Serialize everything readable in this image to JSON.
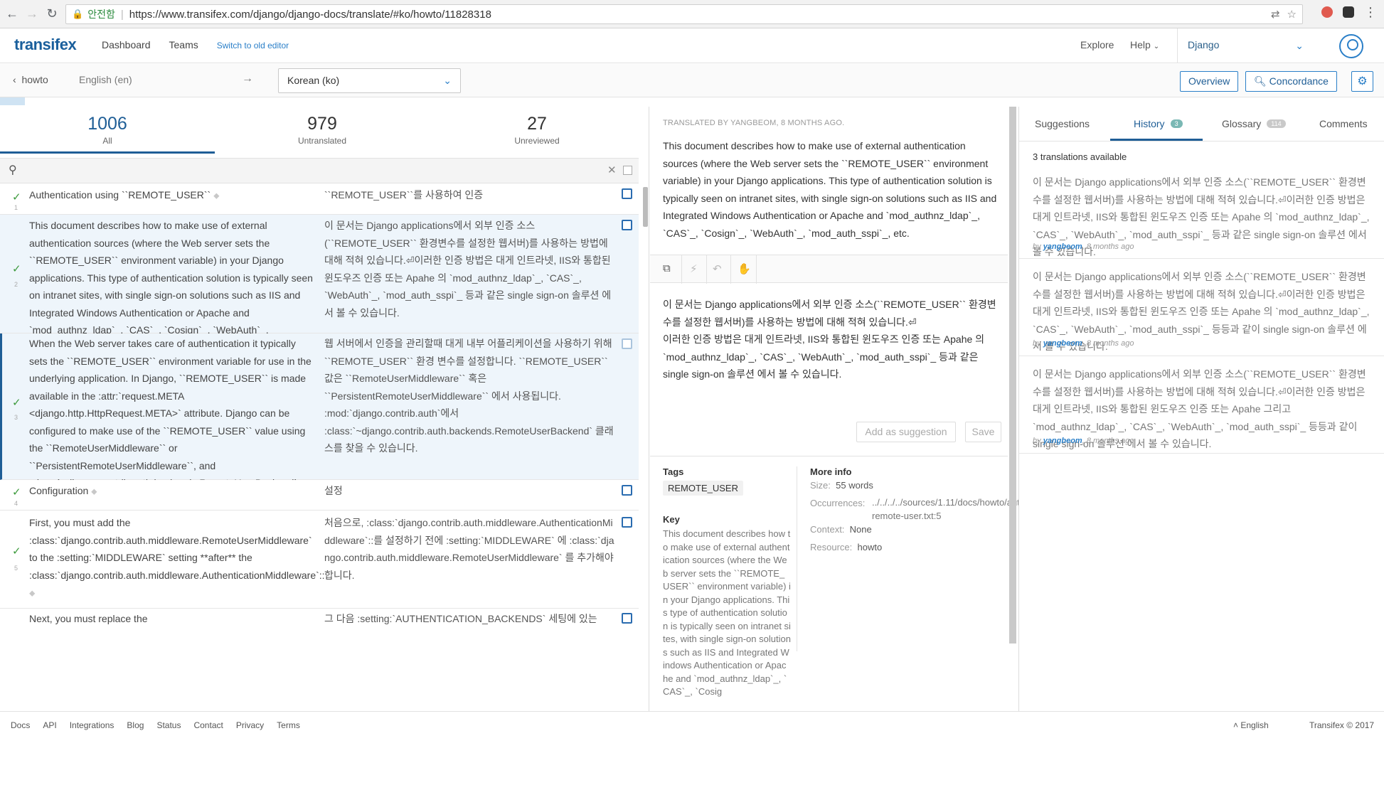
{
  "browser": {
    "secure_label": "안전함",
    "url": "https://www.transifex.com/django/django-docs/translate/#ko/howto/11828318"
  },
  "header": {
    "logo": "transifex",
    "nav": [
      "Dashboard",
      "Teams"
    ],
    "switch_link": "Switch to old editor",
    "explore": "Explore",
    "help": "Help",
    "project": "Django"
  },
  "toolbar": {
    "breadcrumb": "howto",
    "source_lang": "English (en)",
    "arrow": "→",
    "target_lang": "Korean (ko)",
    "overview": "Overview",
    "concordance": "Concordance"
  },
  "stats": [
    {
      "num": "1006",
      "label": "All"
    },
    {
      "num": "979",
      "label": "Untranslated"
    },
    {
      "num": "27",
      "label": "Unreviewed"
    }
  ],
  "search": {
    "placeholder": ""
  },
  "rows": [
    {
      "idx": "1",
      "src": "Authentication using ``REMOTE_USER``",
      "tgt": "``REMOTE_USER``를 사용하여 인증"
    },
    {
      "idx": "2",
      "src": "This document describes how to make use of external authentication sources (where the Web server sets the ``REMOTE_USER`` environment variable) in your Django applications. This type of authentication solution is typically seen on intranet sites, with single sign-on solutions such as IIS and Integrated Windows Authentication or Apache and `mod_authnz_ldap`_, `CAS`_, `Cosign`_, `WebAuth`_, `mod_auth_sspi`_, etc.",
      "tgt": "이 문서는 Django applications에서 외부 인증 소스(``REMOTE_USER`` 환경변수를 설정한 웹서버)를 사용하는 방법에 대해 적혀 있습니다.⏎이러한 인증 방법은 대게 인트라넷, IIS와 통합된 윈도우즈 인증 또는 Apahe 의 `mod_authnz_ldap`_, `CAS`_, `WebAuth`_, `mod_auth_sspi`_ 등과 같은 single sign-on 솔루션 에서 볼 수 있습니다."
    },
    {
      "idx": "3",
      "src": "When the Web server takes care of authentication it typically sets the ``REMOTE_USER`` environment variable for use in the underlying application. In Django, ``REMOTE_USER`` is made available in the :attr:`request.META <django.http.HttpRequest.META>` attribute. Django can be configured to make use of the ``REMOTE_USER`` value using the ``RemoteUserMiddleware`` or ``PersistentRemoteUserMiddleware``, and :class:`~django.contrib.auth.backends.RemoteUserBackend` classes found in :mod:`django.contrib.auth`.",
      "tgt": "웹 서버에서 인증을 관리할때 대게 내부 어플리케이션을 사용하기 위해 ``REMOTE_USER`` 환경 변수를 설정합니다. ``REMOTE_USER`` 값은 ``RemoteUserMiddleware`` 혹은 ``PersistentRemoteUserMiddleware`` 에서 사용됩니다. :mod:`django.contrib.auth`에서 :class:`~django.contrib.auth.backends.RemoteUserBackend` 클래스를 찾을 수 있습니다."
    },
    {
      "idx": "4",
      "src": "Configuration",
      "tgt": "설정"
    },
    {
      "idx": "5",
      "src": "First, you must add the :class:`django.contrib.auth.middleware.RemoteUserMiddleware` to the :setting:`MIDDLEWARE` setting **after** the :class:`django.contrib.auth.middleware.AuthenticationMiddleware`::",
      "tgt": "처음으로, :class:`django.contrib.auth.middleware.AuthenticationMiddleware`::를 설정하기 전에 :setting:`MIDDLEWARE` 에 :class:`django.contrib.auth.middleware.RemoteUserMiddleware` 를 추가해야 합니다."
    },
    {
      "idx": "6",
      "src": "Next, you must replace the",
      "tgt": "그 다음 :setting:`AUTHENTICATION_BACKENDS` 세팅에 있는"
    }
  ],
  "editor": {
    "translated_by": "TRANSLATED BY YANGBEOM, 8 MONTHS AGO.",
    "source": "This document describes how to make use of external authentication sources (where the Web server sets the ``REMOTE_USER`` environment variable) in your Django applications.  This type of authentication solution is typically seen on intranet sites, with single sign-on solutions such as IIS and Integrated Windows Authentication or Apache and `mod_authnz_ldap`_, `CAS`_, `Cosign`_, `WebAuth`_, `mod_auth_sspi`_, etc.",
    "translation_line1": "이 문서는 Django applications에서 외부 인증 소스(``REMOTE_USER`` 환경변수를 설정한 웹서버)를 사용하는 방법에 대해  적혀 있습니다.⏎",
    "translation_line2": "이러한 인증 방법은 대게 인트라넷, IIS와 통합된 윈도우즈 인증 또는 Apahe 의 `mod_authnz_ldap`_, `CAS`_, `WebAuth`_, `mod_auth_sspi`_ 등과 같은 single sign-on 솔루션 에서 볼 수 있습니다.",
    "add_suggestion": "Add as suggestion",
    "save": "Save"
  },
  "meta": {
    "tags_label": "Tags",
    "tag": "REMOTE_USER",
    "key_label": "Key",
    "key_text": "This document describes how to make use of external authentication sources (where the Web server sets the ``REMOTE_USER`` environment variable) in your Django applications. This type of authentication solution is typically seen on intranet sites, with single sign-on solutions such as IIS and Integrated Windows Authentication or Apache and `mod_authnz_ldap`_, `CAS`_, `Cosig",
    "more_info_label": "More info",
    "size_label": "Size:",
    "size": "55 words",
    "occ_label": "Occurrences:",
    "occ": "../../../../sources/1.11/docs/howto/auth-remote-user.txt:5",
    "context_label": "Context:",
    "context": "None",
    "resource_label": "Resource:",
    "resource": "howto"
  },
  "right": {
    "tabs": [
      "Suggestions",
      "History",
      "Glossary",
      "Comments"
    ],
    "history_count": "3",
    "glossary_count": "114",
    "available": "3 translations available",
    "history": [
      {
        "text": "이 문서는 Django applications에서 외부 인증 소스(``REMOTE_USER`` 환경변수를 설정한 웹서버)를 사용하는 방법에 대해 적혀 있습니다.⏎이러한 인증 방법은 대게 인트라넷, IIS와 통합된 윈도우즈 인증 또는 Apahe 의 `mod_authnz_ldap`_, `CAS`_, `WebAuth`_, `mod_auth_sspi`_ 등과 같은 single sign-on 솔루션 에서 볼 수 있습니다.",
        "by": "by",
        "user": "yangbeom",
        "when": ", 8 months ago"
      },
      {
        "text": "이 문서는 Django applications에서 외부 인증 소스(``REMOTE_USER`` 환경변수를 설정한 웹서버)를 사용하는 방법에 대해 적혀 있습니다.⏎이러한 인증 방법은 대게 인트라넷, IIS와 통합된 윈도우즈 인증 또는 Apahe 의 `mod_authnz_ldap`_, `CAS`_, `WebAuth`_, `mod_auth_sspi`_ 등등과 같이 single sign-on 솔루션 에서 볼 수 있습니다.",
        "by": "by",
        "user": "yangbeom",
        "when": ", 8 months ago"
      },
      {
        "text": "이 문서는 Django applications에서 외부 인증 소스(``REMOTE_USER`` 환경변수를 설정한 웹서버)를 사용하는 방법에 대해 적혀 있습니다.⏎이러한 인증 방법은 대게 인트라넷, IIS와 통합된 윈도우즈 인증 또는 Apahe 그리고 `mod_authnz_ldap`_, `CAS`_, `WebAuth`_, `mod_auth_sspi`_ 등등과 같이 single sign-on 솔루션 에서 볼 수 있습니다.",
        "by": "by",
        "user": "yangbeom",
        "when": ", 8 months ago"
      }
    ]
  },
  "footer": {
    "links": [
      "Docs",
      "API",
      "Integrations",
      "Blog",
      "Status",
      "Contact",
      "Privacy",
      "Terms"
    ],
    "lang": "English",
    "copyright": "Transifex © 2017"
  }
}
